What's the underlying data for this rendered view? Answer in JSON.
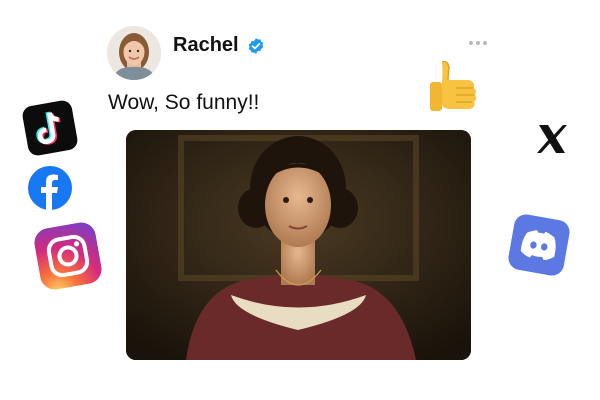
{
  "post": {
    "author": "Rachel",
    "text": "Wow, So funny!!"
  },
  "icons": {
    "verified": "verified-badge-icon",
    "more": "more-horizontal-icon",
    "reaction": "thumbs-up-emoji",
    "social": [
      "tiktok-icon",
      "facebook-icon",
      "instagram-icon",
      "x-icon",
      "discord-icon"
    ]
  },
  "colors": {
    "verified": "#1d9bf0",
    "facebook": "#1877f2",
    "discord": "#5b78e3"
  }
}
